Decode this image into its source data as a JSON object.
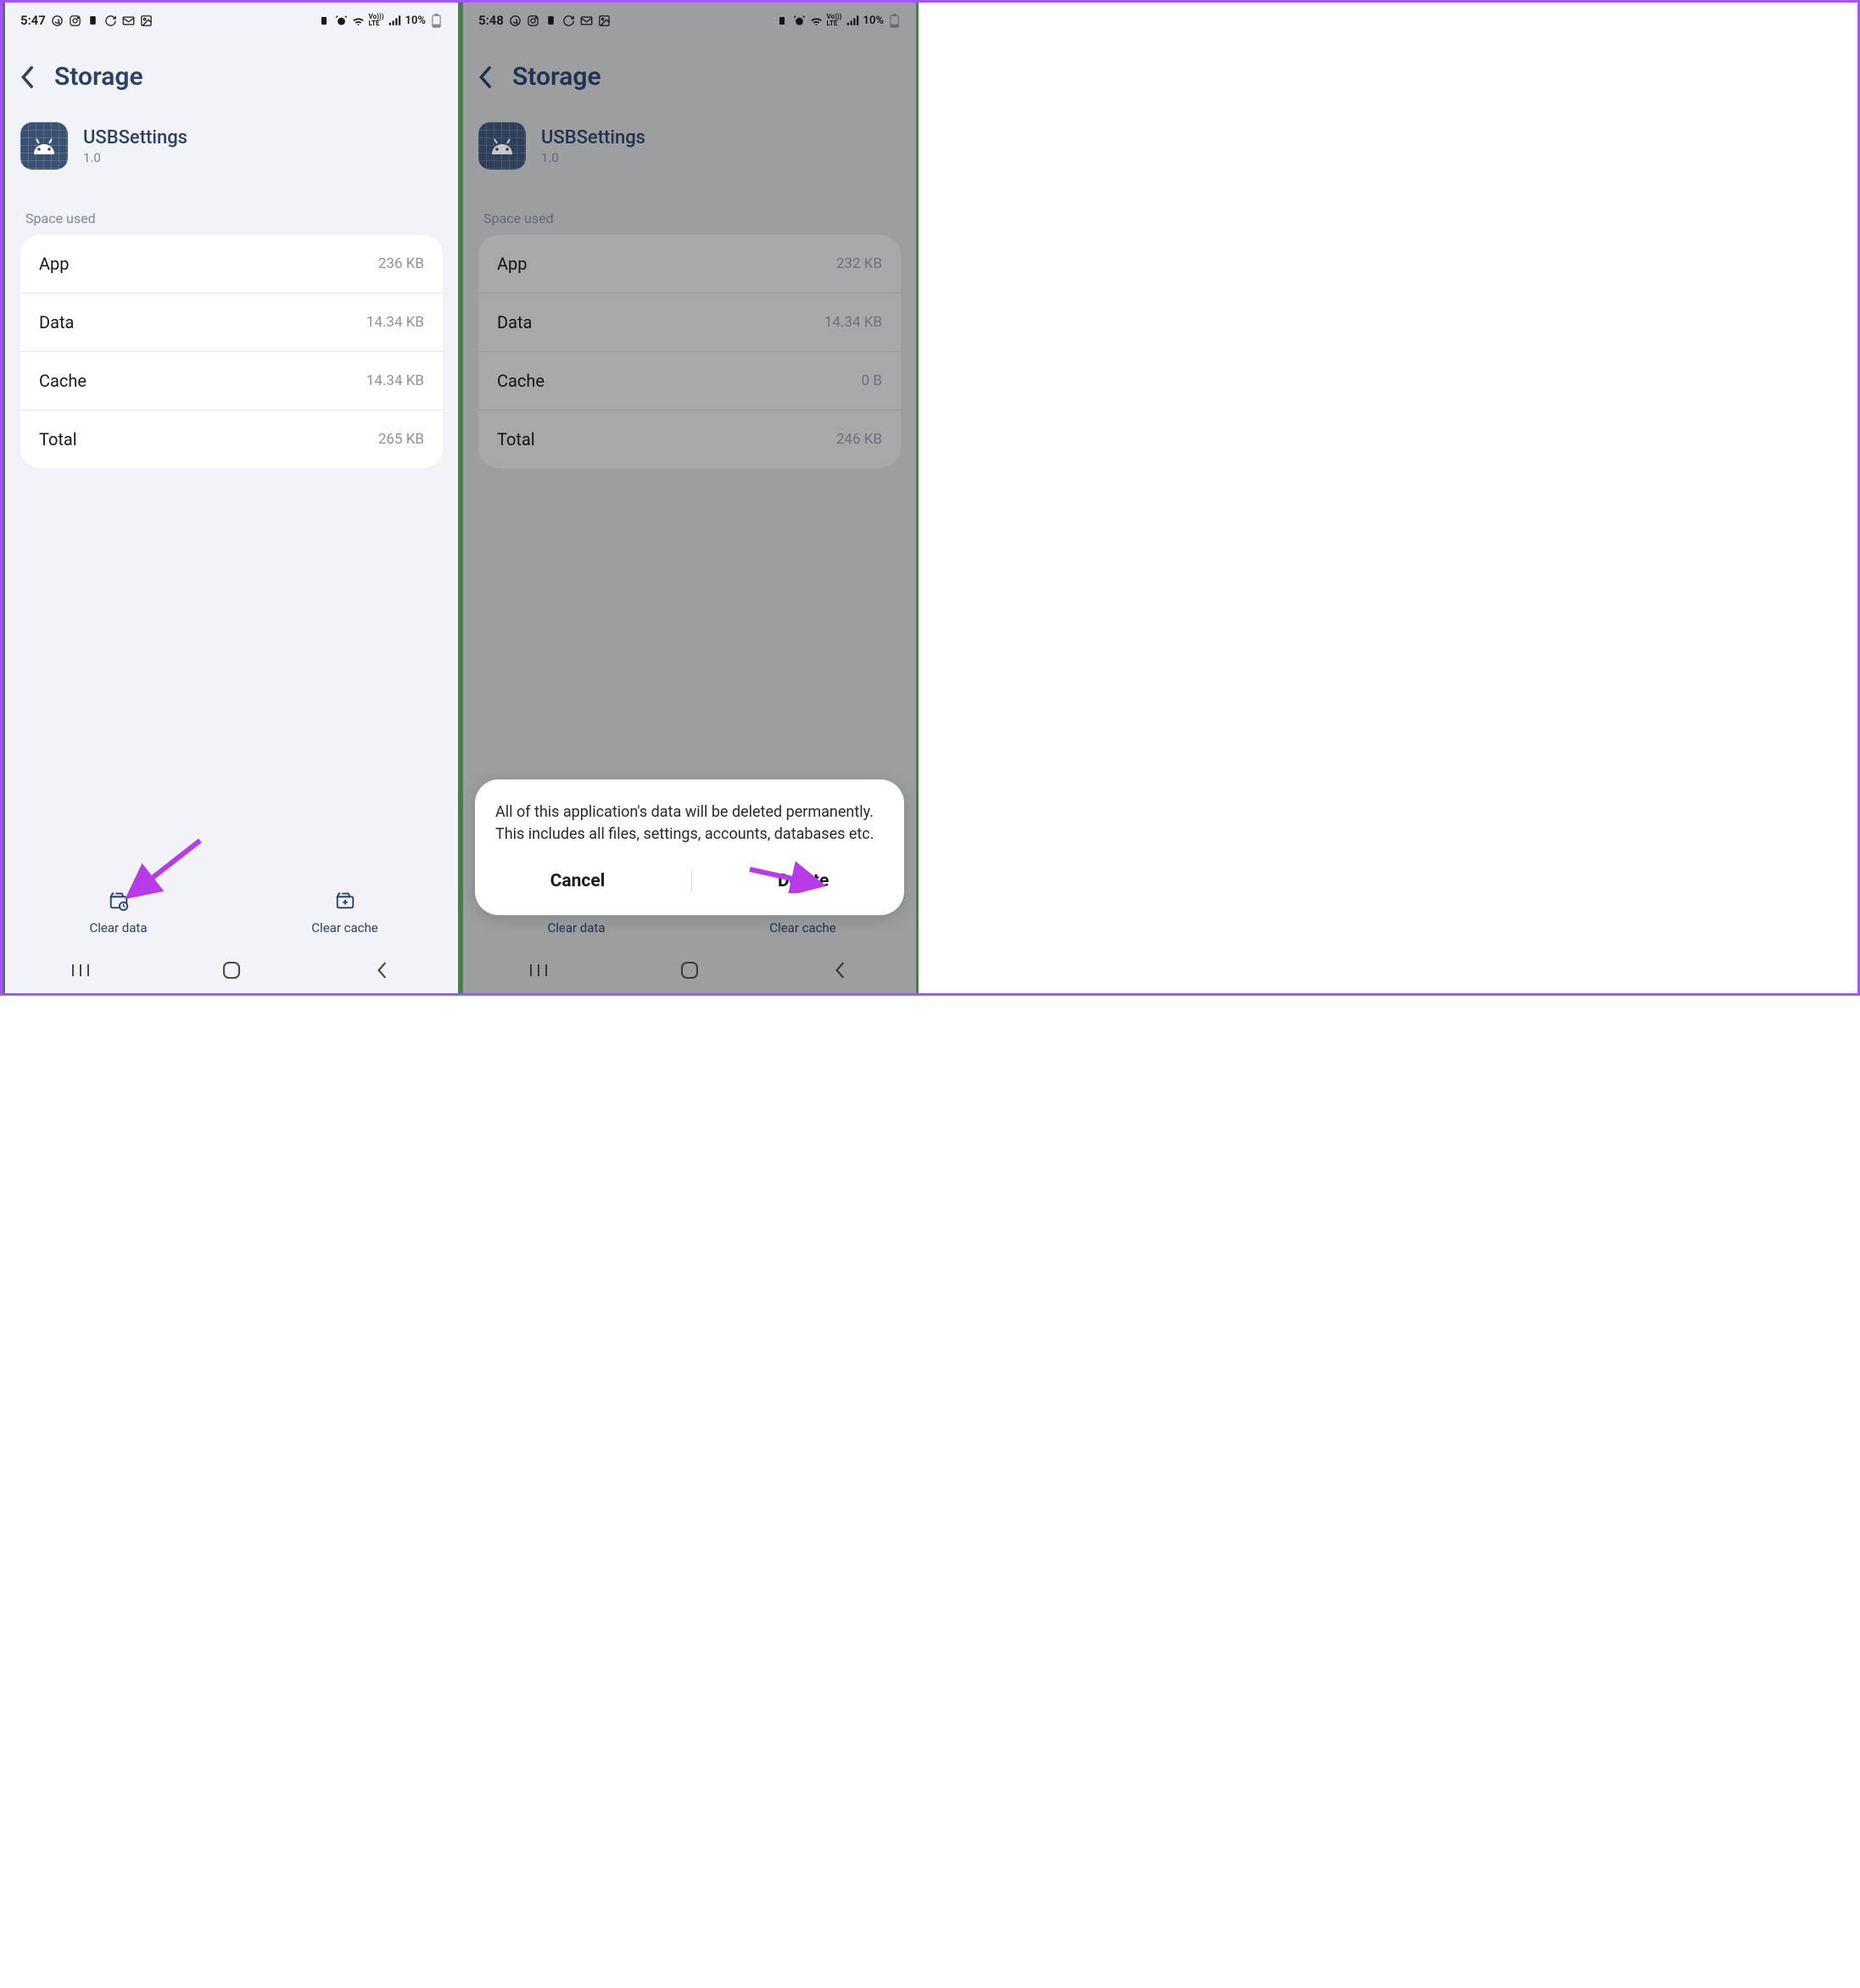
{
  "left": {
    "status": {
      "time": "5:47",
      "battery": "10%"
    },
    "page_title": "Storage",
    "app": {
      "name": "USBSettings",
      "version": "1.0"
    },
    "section": "Space used",
    "rows": [
      {
        "label": "App",
        "value": "236 KB"
      },
      {
        "label": "Data",
        "value": "14.34 KB"
      },
      {
        "label": "Cache",
        "value": "14.34 KB"
      },
      {
        "label": "Total",
        "value": "265 KB"
      }
    ],
    "actions": {
      "clear_data": "Clear data",
      "clear_cache": "Clear cache"
    }
  },
  "right": {
    "status": {
      "time": "5:48",
      "battery": "10%"
    },
    "page_title": "Storage",
    "app": {
      "name": "USBSettings",
      "version": "1.0"
    },
    "section": "Space used",
    "rows": [
      {
        "label": "App",
        "value": "232 KB"
      },
      {
        "label": "Data",
        "value": "14.34 KB"
      },
      {
        "label": "Cache",
        "value": "0 B"
      },
      {
        "label": "Total",
        "value": "246 KB"
      }
    ],
    "actions": {
      "clear_data": "Clear data",
      "clear_cache": "Clear cache"
    },
    "dialog": {
      "text": "All of this application's data will be deleted permanently. This includes all files, settings, accounts, databases etc.",
      "cancel": "Cancel",
      "confirm": "Delete"
    }
  }
}
